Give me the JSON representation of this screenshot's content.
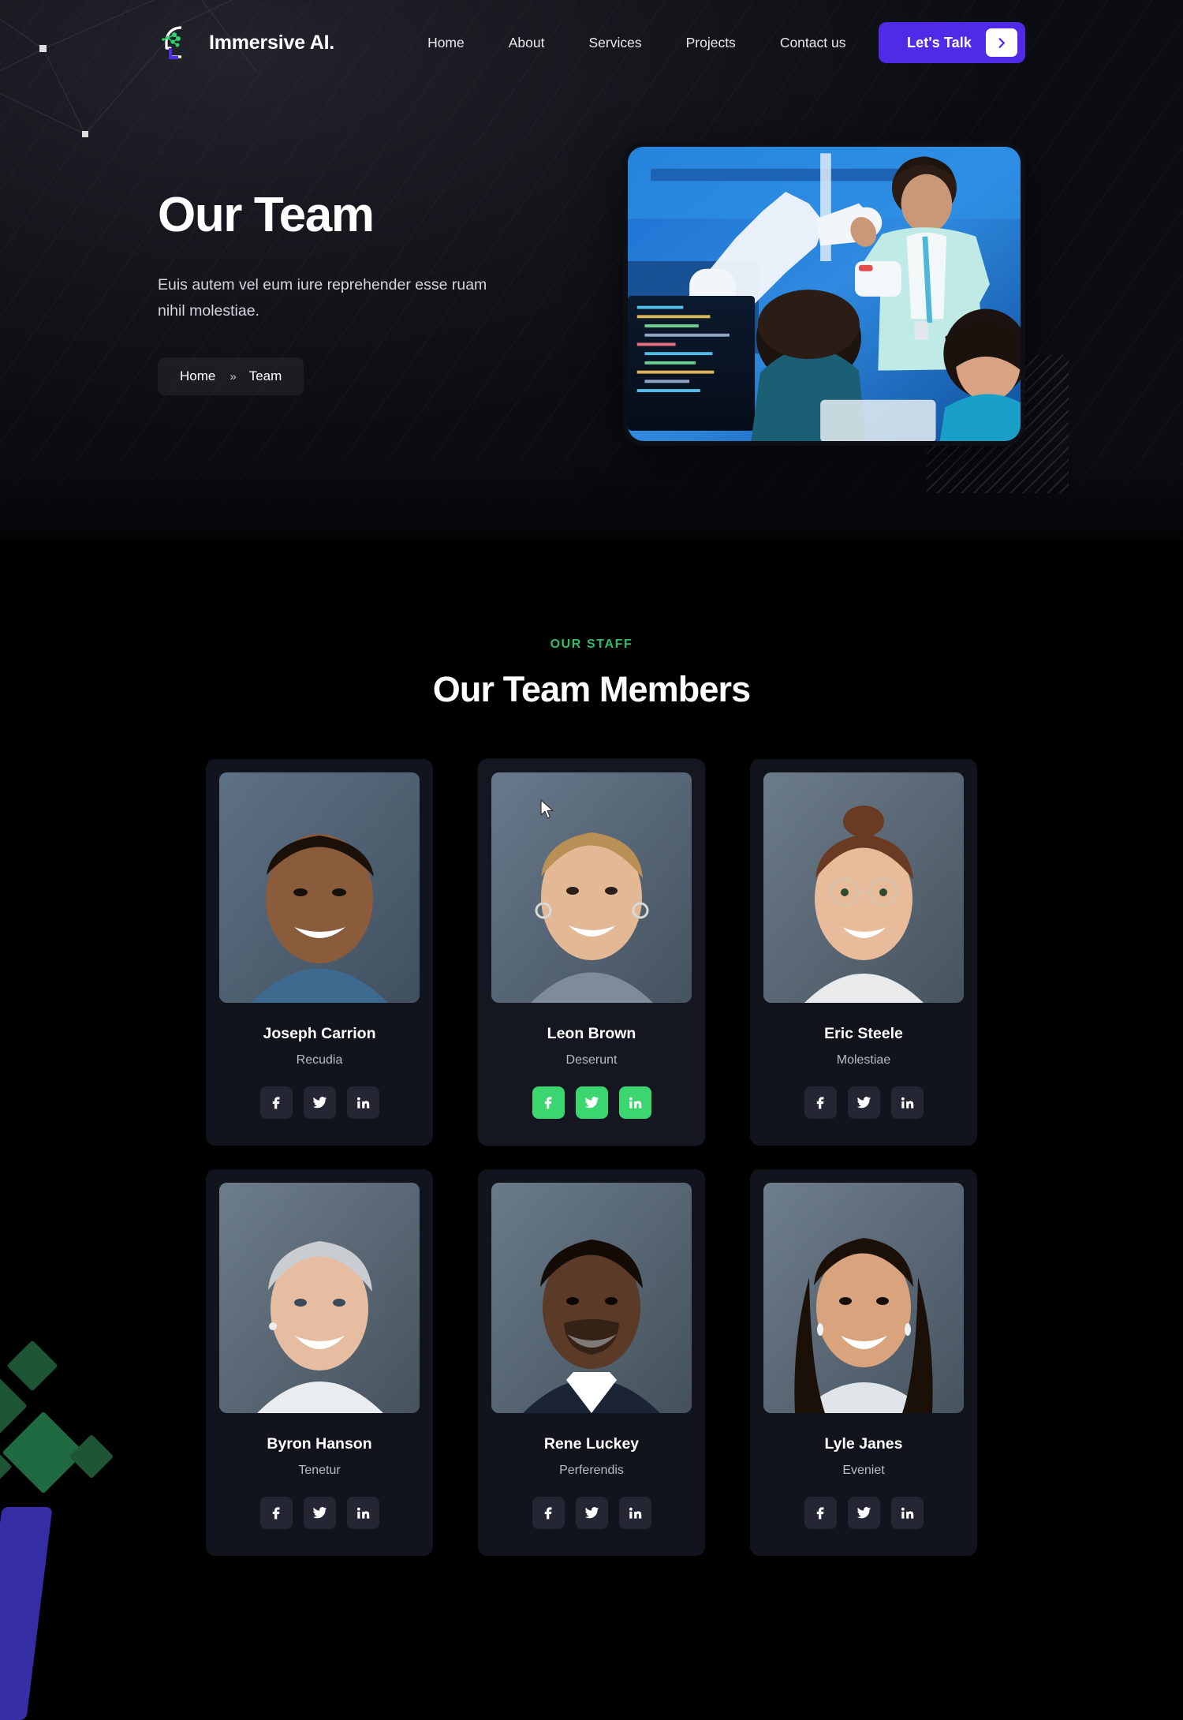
{
  "brand": {
    "name": "Immersive AI.",
    "logo_icon": "ai-head-node-icon"
  },
  "nav": {
    "items": [
      {
        "label": "Home"
      },
      {
        "label": "About"
      },
      {
        "label": "Services"
      },
      {
        "label": "Projects"
      },
      {
        "label": "Contact us"
      }
    ],
    "cta": {
      "label": "Let's Talk",
      "icon": "chevron-right-icon",
      "color": "#4F2BE8"
    }
  },
  "hero": {
    "title": "Our Team",
    "subtitle": "Euis autem vel eum iure reprehender esse ruam nihil molestiae.",
    "breadcrumb": {
      "home": "Home",
      "separator": "»",
      "current": "Team"
    },
    "image_alt": "engineers-with-robotic-arm-in-lab"
  },
  "team_section": {
    "eyebrow": "OUR STAFF",
    "eyebrow_color": "#2EBD6B",
    "title": "Our Team Members",
    "hover_accent": "#3BD66F",
    "social_icons": [
      "facebook-icon",
      "twitter-icon",
      "linkedin-icon"
    ],
    "members": [
      {
        "name": "Joseph Carrion",
        "role": "Recudia",
        "hovered": false
      },
      {
        "name": "Leon Brown",
        "role": "Deserunt",
        "hovered": true
      },
      {
        "name": "Eric Steele",
        "role": "Molestiae",
        "hovered": false
      },
      {
        "name": "Byron Hanson",
        "role": "Tenetur",
        "hovered": false
      },
      {
        "name": "Rene Luckey",
        "role": "Perferendis",
        "hovered": false
      },
      {
        "name": "Lyle Janes",
        "role": "Eveniet",
        "hovered": false
      }
    ]
  }
}
